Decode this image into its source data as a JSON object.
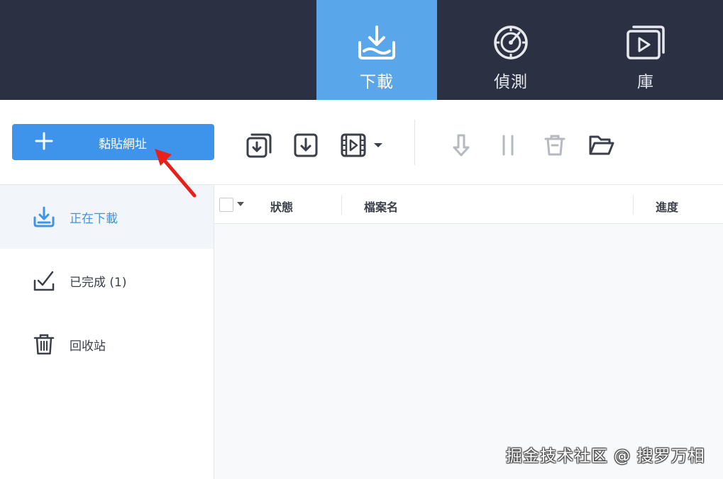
{
  "nav": {
    "tabs": [
      {
        "label": "下載",
        "icon": "download-tray-icon",
        "active": true
      },
      {
        "label": "偵測",
        "icon": "detect-target-icon",
        "active": false
      },
      {
        "label": "庫",
        "icon": "video-library-icon",
        "active": false
      }
    ]
  },
  "toolbar": {
    "paste_label": "黏貼網址",
    "icons": [
      "batch-download-icon",
      "download-box-icon",
      "video-download-icon",
      "dropdown-caret-icon",
      "resume-icon",
      "pause-icon",
      "delete-icon",
      "open-folder-icon"
    ]
  },
  "sidebar": {
    "items": [
      {
        "label": "正在下載",
        "icon": "downloading-icon",
        "active": true
      },
      {
        "label": "已完成 (1)",
        "icon": "completed-check-icon",
        "active": false
      },
      {
        "label": "回收站",
        "icon": "trash-icon",
        "active": false
      }
    ]
  },
  "table": {
    "columns": [
      "狀態",
      "檔案名",
      "進度"
    ]
  },
  "watermark": "掘金技术社区 @ 搜罗万相",
  "colors": {
    "header_bg": "#2b3142",
    "active_tab": "#5aa6ea",
    "primary": "#3e94ea",
    "annotation": "#e8201a"
  }
}
